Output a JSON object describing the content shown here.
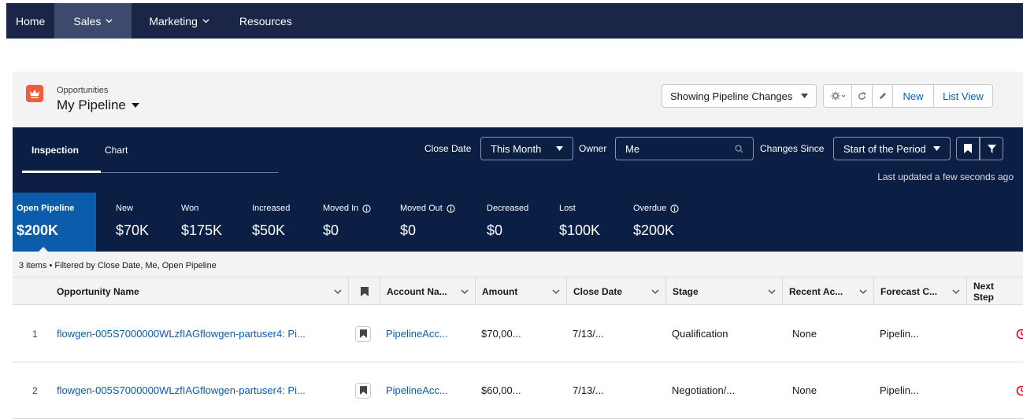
{
  "nav": {
    "home": "Home",
    "sales": "Sales",
    "marketing": "Marketing",
    "resources": "Resources"
  },
  "header": {
    "object_type": "Opportunities",
    "list_title": "My Pipeline",
    "showing_button": "Showing Pipeline Changes",
    "new_button": "New",
    "list_view_button": "List View"
  },
  "panel": {
    "tabs": [
      "Inspection",
      "Chart"
    ],
    "close_date_label": "Close Date",
    "close_date_value": "This Month",
    "owner_label": "Owner",
    "owner_value": "Me",
    "changes_since_label": "Changes Since",
    "changes_since_value": "Start of the Period",
    "last_updated": "Last updated a few seconds ago",
    "metrics": [
      {
        "label": "Open Pipeline",
        "value": "$200K"
      },
      {
        "label": "New",
        "value": "$70K"
      },
      {
        "label": "Won",
        "value": "$175K"
      },
      {
        "label": "Increased",
        "value": "$50K"
      },
      {
        "label": "Moved In",
        "value": "$0"
      },
      {
        "label": "Moved Out",
        "value": "$0"
      },
      {
        "label": "Decreased",
        "value": "$0"
      },
      {
        "label": "Lost",
        "value": "$100K"
      },
      {
        "label": "Overdue",
        "value": "$200K"
      }
    ]
  },
  "table": {
    "info": "3 items • Filtered by Close Date, Me, Open Pipeline",
    "columns": [
      "Opportunity Name",
      "Account Na...",
      "Amount",
      "Close Date",
      "Stage",
      "Recent Ac...",
      "Forecast C...",
      "Next Step"
    ],
    "rows": [
      {
        "num": "1",
        "name": "flowgen-005S7000000WLzfIAGflowgen-partuser4: Pi...",
        "account": "PipelineAcc...",
        "amount": "$70,00...",
        "close_date": "7/13/...",
        "stage": "Qualification",
        "recent": "None",
        "forecast": "Pipelin..."
      },
      {
        "num": "2",
        "name": "flowgen-005S7000000WLzfIAGflowgen-partuser4: Pi...",
        "account": "PipelineAcc...",
        "amount": "$60,00...",
        "close_date": "7/13/...",
        "stage": "Negotiation/...",
        "recent": "None",
        "forecast": "Pipelin..."
      }
    ]
  },
  "colors": {
    "nav_bg": "#1b2547",
    "panel_bg": "#0b1f45",
    "active_metric": "#0b5cab",
    "link": "#0b5cab",
    "brand_icon": "#f15a3a",
    "alert": "#ea001e"
  },
  "icons": [
    "chevron-down-icon",
    "crown-icon",
    "caret-down-icon",
    "gear-icon",
    "refresh-icon",
    "pencil-icon",
    "search-icon",
    "bookmark-icon",
    "filter-icon",
    "info-icon",
    "clock-icon"
  ]
}
